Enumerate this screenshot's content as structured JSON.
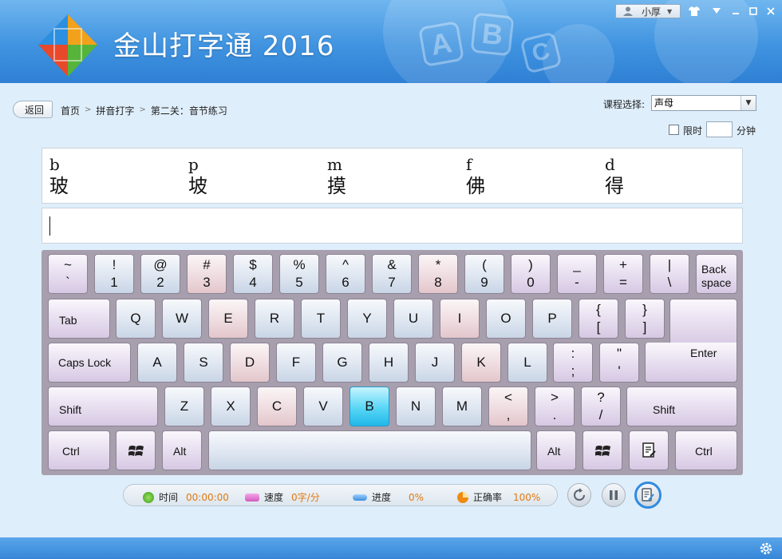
{
  "app": {
    "title": "金山打字通 2016",
    "user": "小厚"
  },
  "nav": {
    "back": "返回",
    "breadcrumb": [
      "首页",
      "拼音打字",
      "第二关：音节练习"
    ],
    "course_label": "课程选择:",
    "course_value": "声母",
    "limit_label": "限时",
    "limit_unit": "分钟"
  },
  "practice": [
    {
      "pinyin": "b",
      "hanzi": "玻"
    },
    {
      "pinyin": "p",
      "hanzi": "坡"
    },
    {
      "pinyin": "m",
      "hanzi": "摸"
    },
    {
      "pinyin": "f",
      "hanzi": "佛"
    },
    {
      "pinyin": "d",
      "hanzi": "得"
    }
  ],
  "keyboard": {
    "row1": [
      [
        "~",
        "`"
      ],
      [
        "!",
        "1"
      ],
      [
        "@",
        "2"
      ],
      [
        "#",
        "3"
      ],
      [
        "$",
        "4"
      ],
      [
        "%",
        "5"
      ],
      [
        "^",
        "6"
      ],
      [
        "&",
        "7"
      ],
      [
        "*",
        "8"
      ],
      [
        "(",
        "9"
      ],
      [
        ")",
        "0"
      ],
      [
        "_",
        "-"
      ],
      [
        "+",
        "="
      ],
      [
        "|",
        "\\"
      ]
    ],
    "backspace": "Back space",
    "tab": "Tab",
    "row2": [
      "Q",
      "W",
      "E",
      "R",
      "T",
      "Y",
      "U",
      "I",
      "O",
      "P"
    ],
    "row2_sym": [
      [
        "{",
        "["
      ],
      [
        "}",
        "]"
      ]
    ],
    "caps": "Caps Lock",
    "row3": [
      "A",
      "S",
      "D",
      "F",
      "G",
      "H",
      "J",
      "K",
      "L"
    ],
    "row3_sym": [
      [
        ":",
        ";"
      ],
      [
        "\"",
        "'"
      ]
    ],
    "enter": "Enter",
    "shift": "Shift",
    "row4": [
      "Z",
      "X",
      "C",
      "V",
      "B",
      "N",
      "M"
    ],
    "row4_sym": [
      [
        "<",
        ","
      ],
      [
        ">",
        "."
      ],
      [
        "?",
        "/"
      ]
    ],
    "ctrl": "Ctrl",
    "alt": "Alt",
    "active_key": "B"
  },
  "status": {
    "time_label": "时间",
    "time_value": "00:00:00",
    "speed_label": "速度",
    "speed_value": "0字/分",
    "progress_label": "进度",
    "progress_value": "0%",
    "accuracy_label": "正确率",
    "accuracy_value": "100%"
  },
  "colors": {
    "header": "#3f93e0",
    "active_key": "#58d6f6",
    "status_value": "#e07a10"
  }
}
